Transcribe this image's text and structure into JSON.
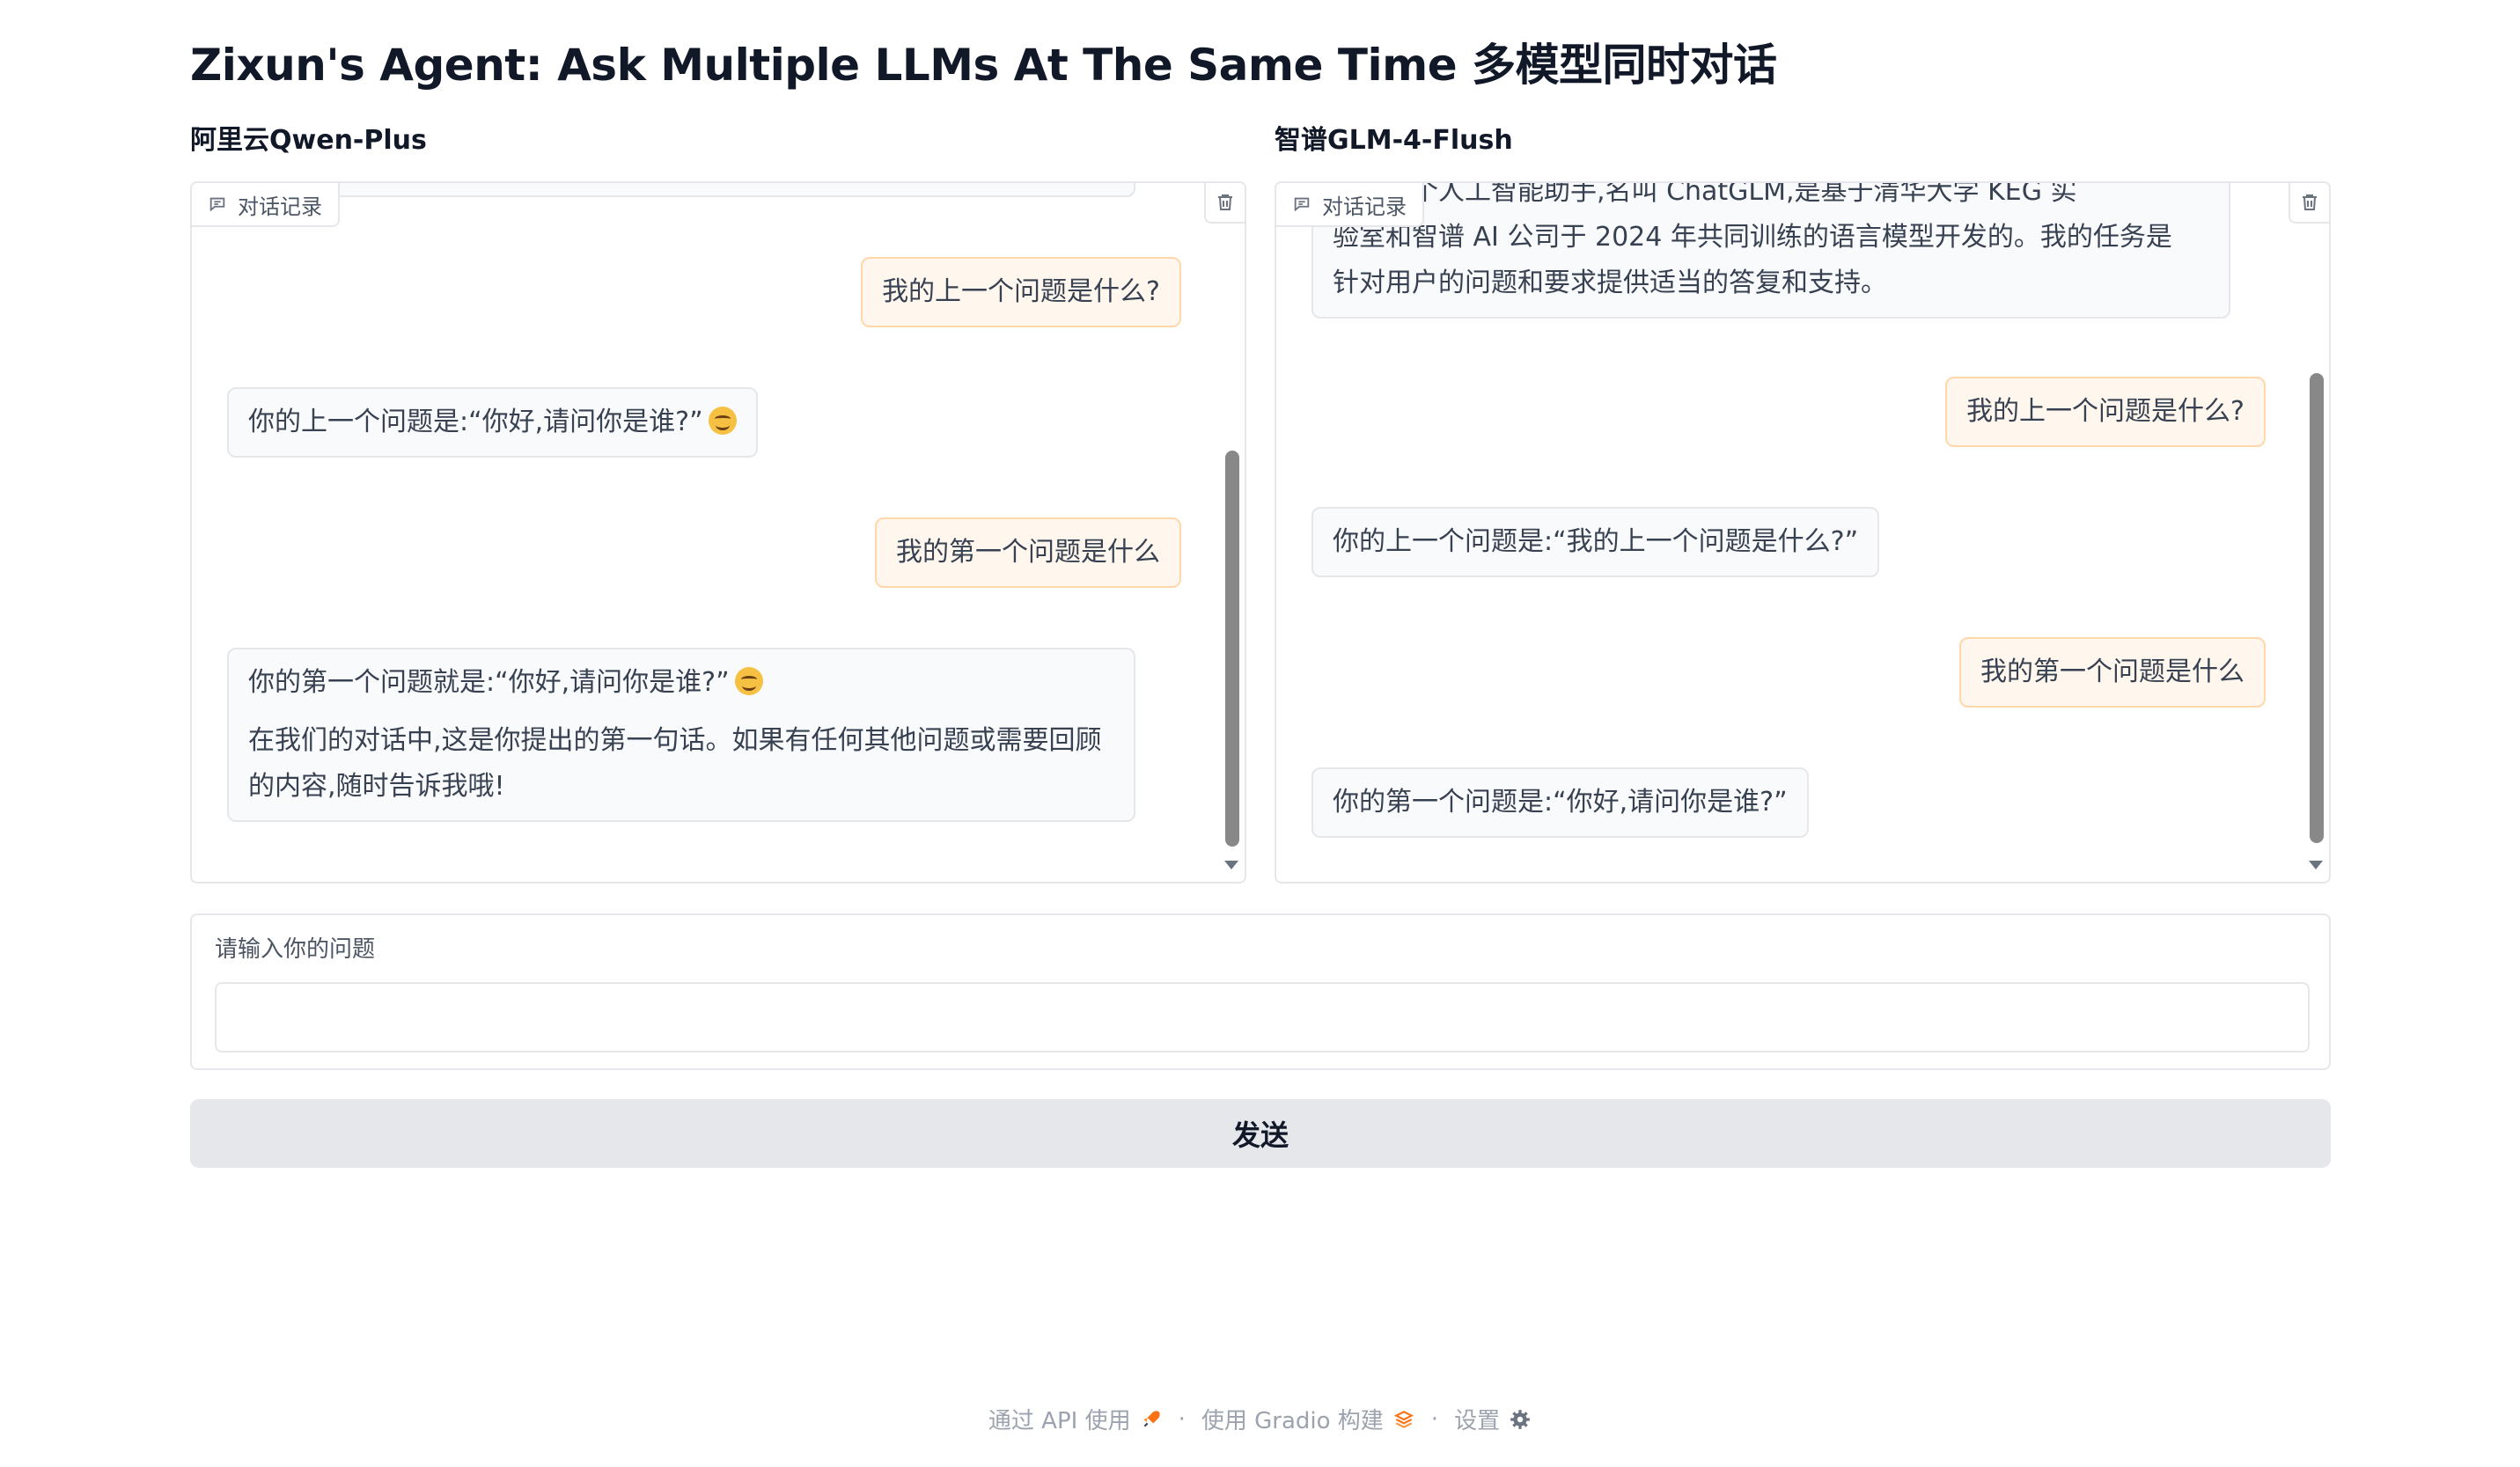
{
  "page": {
    "title": "Zixun's Agent: Ask Multiple LLMs At The Same Time 多模型同时对话"
  },
  "panels": {
    "left": {
      "label": "阿里云Qwen-Plus",
      "tag": "对话记录",
      "messages": [
        {
          "role": "user",
          "text": "我的上一个问题是什么?"
        },
        {
          "role": "bot",
          "text": "你的上一个问题是:“你好,请问你是谁?”",
          "emoji": "smiling-face"
        },
        {
          "role": "user",
          "text": "我的第一个问题是什么"
        },
        {
          "role": "bot",
          "text": "你的第一个问题就是:“你好,请问你是谁?”",
          "emoji": "smiling-face",
          "text2": "在我们的对话中,这是你提出的第一句话。如果有任何其他问题或需要回顾的内容,随时告诉我哦!"
        }
      ]
    },
    "right": {
      "label": "智谱GLM-4-Flush",
      "tag": "对话记录",
      "messages": [
        {
          "role": "bot",
          "lines": [
            "我是一个人工智能助手,名叫 ChatGLM,是基于清华大学 KEG 实",
            "验室和智谱 AI 公司于 2024 年共同训练的语言模型开发的。我的任务是",
            "针对用户的问题和要求提供适当的答复和支持。"
          ]
        },
        {
          "role": "user",
          "text": "我的上一个问题是什么?"
        },
        {
          "role": "bot",
          "text": "你的上一个问题是:“我的上一个问题是什么?”"
        },
        {
          "role": "user",
          "text": "我的第一个问题是什么"
        },
        {
          "role": "bot",
          "text": "你的第一个问题是:“你好,请问你是谁?”"
        }
      ]
    }
  },
  "input": {
    "label": "请输入你的问题",
    "value": "",
    "placeholder": ""
  },
  "send_button": {
    "label": "发送"
  },
  "footer": {
    "api_label": "通过 API 使用",
    "separator": "·",
    "built_label": "使用 Gradio 构建",
    "settings_label": "设置"
  },
  "icons": {
    "chat_tag": "chat-bubble-icon",
    "clear": "trash-icon",
    "api": "rocket-icon",
    "gradio": "gradio-logo-icon",
    "settings": "gear-icon"
  },
  "colors": {
    "user_bubble_bg": "#fff7ed",
    "user_bubble_border": "#fed7aa",
    "bot_bubble_bg": "#f9fafb",
    "button_bg": "#e5e7eb",
    "accent": "#f97316"
  }
}
